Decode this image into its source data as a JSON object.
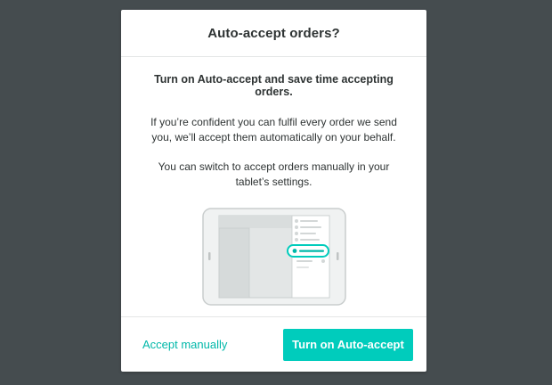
{
  "colors": {
    "backdrop": "#454c4f",
    "accent": "#00ccbc",
    "accent_text": "#00b8a9",
    "text": "#2e3333"
  },
  "dialog": {
    "title": "Auto-accept orders?",
    "lead": "Turn on Auto-accept and save time accepting orders.",
    "paragraph_1": "If you’re confident you can fulfil every order we send you, we’ll accept them automatically on your behalf.",
    "paragraph_2": "You can switch to accept orders manually in your tablet’s settings.",
    "illustration_icon": "tablet-settings-toggle-icon",
    "secondary_button": "Accept manually",
    "primary_button": "Turn on Auto-accept"
  }
}
